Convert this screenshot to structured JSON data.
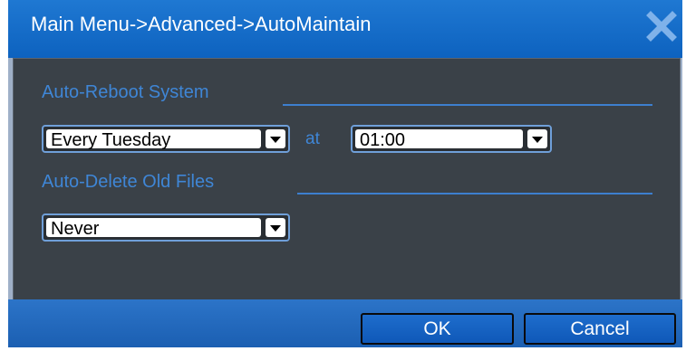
{
  "window": {
    "title": "Main Menu->Advanced->AutoMaintain",
    "close_icon": "close-icon"
  },
  "auto_reboot": {
    "label": "Auto-Reboot System",
    "day_value": "Every Tuesday",
    "at_label": "at",
    "time_value": "01:00"
  },
  "auto_delete": {
    "label": "Auto-Delete Old Files",
    "value": "Never"
  },
  "footer": {
    "ok_label": "OK",
    "cancel_label": "Cancel"
  },
  "colors": {
    "title_bar": "#1170cc",
    "panel_bg": "#3a4148",
    "label_blue": "#3f86d6"
  }
}
